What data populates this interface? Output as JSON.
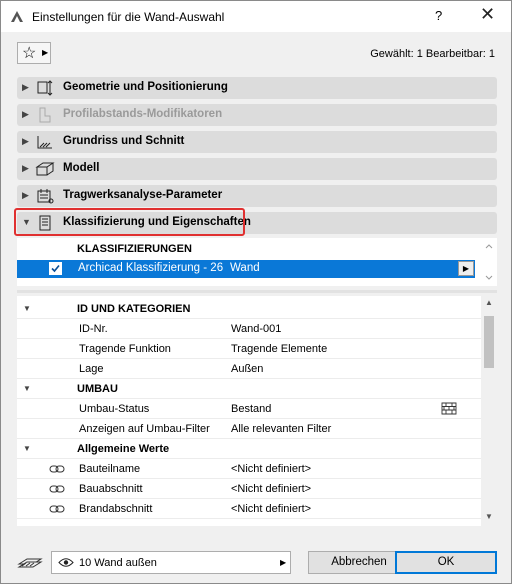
{
  "window": {
    "title": "Einstellungen für die Wand-Auswahl",
    "help": "?",
    "close": "✕"
  },
  "toolbar": {
    "favorites_star": "☆",
    "selection_info": "Gewählt: 1 Bearbeitbar: 1"
  },
  "panels": [
    {
      "label": "Geometrie und Positionierung",
      "icon": "geometry-icon",
      "expanded": false,
      "disabled": false
    },
    {
      "label": "Profilabstands-Modifikatoren",
      "icon": "profile-offset-icon",
      "expanded": false,
      "disabled": true
    },
    {
      "label": "Grundriss und Schnitt",
      "icon": "floorplan-section-icon",
      "expanded": false,
      "disabled": false
    },
    {
      "label": "Modell",
      "icon": "model-icon",
      "expanded": false,
      "disabled": false
    },
    {
      "label": "Tragwerksanalyse-Parameter",
      "icon": "structural-analysis-icon",
      "expanded": false,
      "disabled": false
    },
    {
      "label": "Klassifizierung und Eigenschaften",
      "icon": "classification-icon",
      "expanded": true,
      "disabled": false
    }
  ],
  "classifications": {
    "heading": "KLASSIFIZIERUNGEN",
    "rows": [
      {
        "checked": true,
        "system": "Archicad Klassifizierung - 26",
        "value": "Wand"
      }
    ]
  },
  "properties": {
    "groups": [
      {
        "title": "ID UND KATEGORIEN",
        "rows": [
          {
            "key": "ID-Nr.",
            "value": "Wand-001"
          },
          {
            "key": "Tragende Funktion",
            "value": "Tragende Elemente"
          },
          {
            "key": "Lage",
            "value": "Außen"
          }
        ]
      },
      {
        "title": "UMBAU",
        "rows": [
          {
            "key": "Umbau-Status",
            "value": "Bestand"
          },
          {
            "key": "Anzeigen auf Umbau-Filter",
            "value": "Alle relevanten Filter"
          }
        ]
      },
      {
        "title": "Allgemeine Werte",
        "rows": [
          {
            "key": "Bauteilname",
            "value": "<Nicht definiert>"
          },
          {
            "key": "Bauabschnitt",
            "value": "<Nicht definiert>"
          },
          {
            "key": "Brandabschnitt",
            "value": "<Nicht definiert>"
          }
        ]
      }
    ]
  },
  "footer": {
    "favorite_value": "10 Wand außen",
    "cancel_label": "Abbrechen",
    "ok_label": "OK"
  }
}
